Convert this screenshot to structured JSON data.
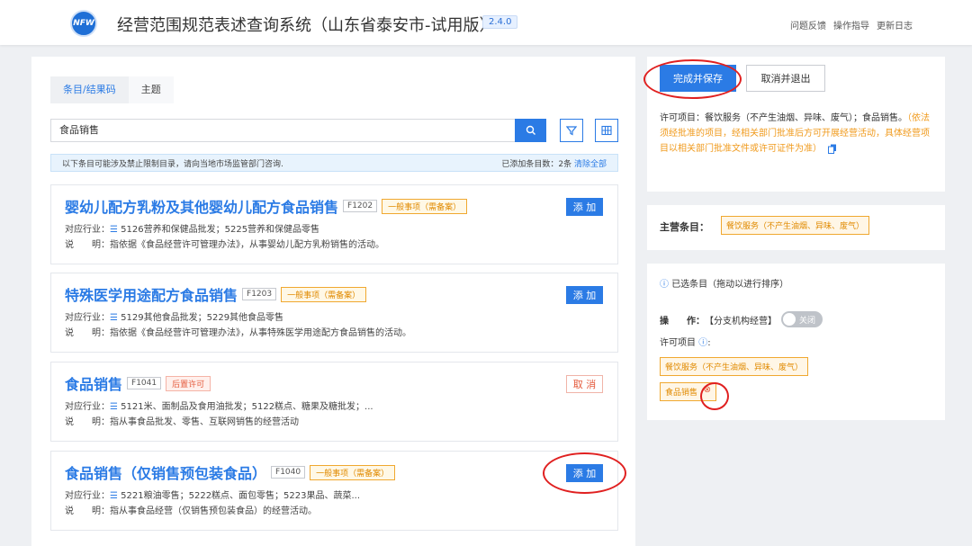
{
  "header": {
    "logo_text": "NFW",
    "title": "经营范围规范表述查询系统（山东省泰安市-试用版）",
    "version": "2.4.0",
    "links": [
      "问题反馈",
      "操作指导",
      "更新日志"
    ]
  },
  "left": {
    "tabs": [
      "条目/结果码",
      "主题"
    ],
    "search_value": "食品销售",
    "notice": "以下条目可能涉及禁止限制目录，请向当地市场监管部门咨询.",
    "added_count_label": "已添加条目数：2条",
    "clear_all": "清除全部",
    "industry_label": "对应行业：",
    "desc_label": "说　　明：",
    "cards": [
      {
        "name": "婴幼儿配方乳粉及其他婴幼儿配方食品销售",
        "code": "F1202",
        "tag": "一般事项（需备案）",
        "tag_type": "orange",
        "industry": "5126营养和保健品批发；5225营养和保健品零售",
        "desc": "指依据《食品经营许可管理办法》，从事婴幼儿配方乳粉销售的活动。",
        "action": "添 加",
        "action_type": "add"
      },
      {
        "name": "特殊医学用途配方食品销售",
        "code": "F1203",
        "tag": "一般事项（需备案）",
        "tag_type": "orange",
        "industry": "5129其他食品批发；5229其他食品零售",
        "desc": "指依据《食品经营许可管理办法》，从事特殊医学用途配方食品销售的活动。",
        "action": "添 加",
        "action_type": "add"
      },
      {
        "name": "食品销售",
        "code": "F1041",
        "tag": "后置许可",
        "tag_type": "red",
        "industry": "5121米、面制品及食用油批发；5122糕点、糖果及糖批发；...",
        "desc": "指从事食品批发、零售、互联网销售的经营活动",
        "action": "取 消",
        "action_type": "cancel"
      },
      {
        "name": "食品销售（仅销售预包装食品）",
        "code": "F1040",
        "tag": "一般事项（需备案）",
        "tag_type": "orange",
        "industry": "5221粮油零售；5222糕点、面包零售；5223果品、蔬菜...",
        "desc": "指从事食品经营（仅销售预包装食品）的经营活动。",
        "action": "添 加",
        "action_type": "add"
      }
    ]
  },
  "right": {
    "save_label": "完成并保存",
    "exit_label": "取消并退出",
    "permit_text": "许可项目：餐饮服务（不产生油烟、异味、废气）；食品销售。",
    "permit_warn": "（依法须经批准的项目，经相关部门批准后方可开展经营活动，具体经营项目以相关部门批准文件或许可证件为准）",
    "main_label": "主营条目：",
    "main_item": "餐饮服务（不产生油烟、异味、废气）",
    "selected_head": "已选条目（拖动以进行排序）",
    "op_label": "操　　作：",
    "op_value": "【分支机构经营】",
    "toggle_label": "关闭",
    "permit_items_label": "许可项目",
    "permit_items": [
      "餐饮服务（不产生油烟、异味、废气）",
      "食品销售"
    ]
  },
  "colors": {
    "primary": "#2b7be5",
    "warn": "#f09a1c",
    "annotation": "#e02020"
  }
}
